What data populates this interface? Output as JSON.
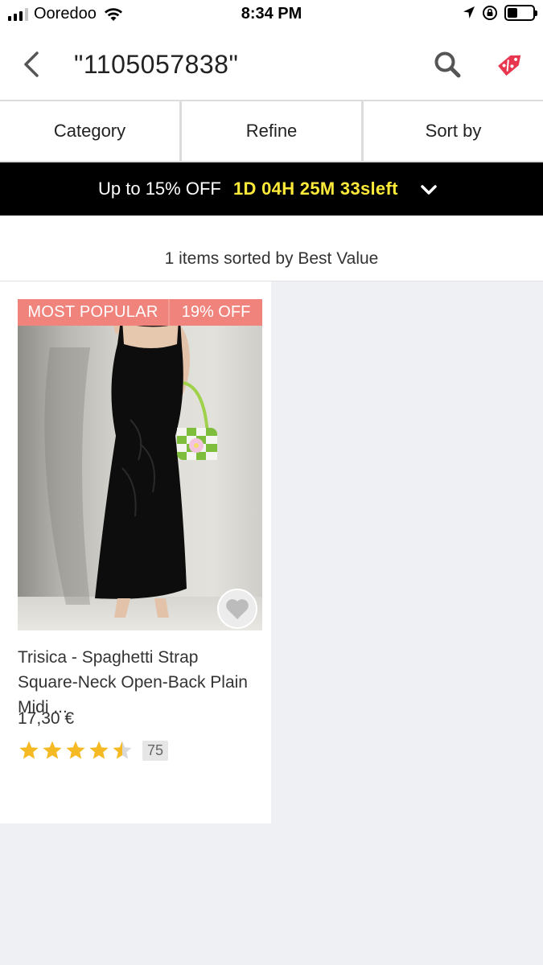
{
  "status_bar": {
    "carrier": "Ooredoo",
    "time": "8:34 PM"
  },
  "header": {
    "search_query": "\"1105057838\"",
    "back_icon": "chevron-left-icon",
    "search_icon": "search-icon",
    "deals_icon": "percent-tag-icon",
    "deals_color": "#e8364f"
  },
  "filters": {
    "category": "Category",
    "refine": "Refine",
    "sort_by": "Sort by"
  },
  "promo": {
    "text": "Up to 15% OFF",
    "countdown": "1D 04H 25M 33sleft",
    "countdown_color": "#ffea3a",
    "toggle_icon": "chevron-down-icon"
  },
  "results": {
    "summary": "1 items sorted by Best Value"
  },
  "products": [
    {
      "badge_popular": "MOST POPULAR",
      "badge_discount": "19% OFF",
      "badge_color": "#f0847c",
      "title": "Trisica - Spaghetti Strap Square-Neck Open-Back Plain Midi ...",
      "price": "17,30 €",
      "rating": 4.5,
      "rating_max": 5,
      "review_count": "75",
      "star_color": "#f5b923",
      "wishlist_icon": "heart-icon"
    }
  ]
}
